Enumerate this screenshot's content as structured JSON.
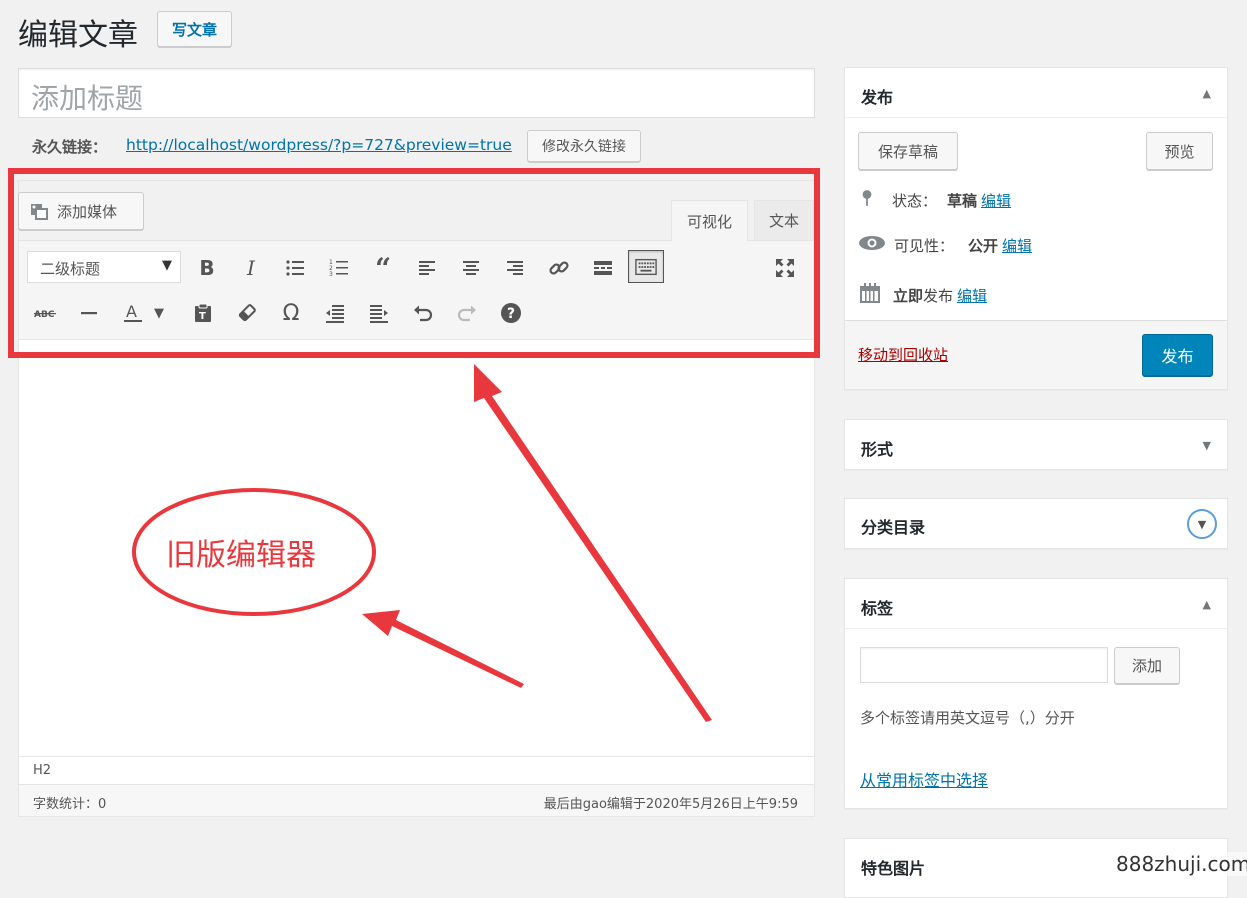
{
  "header": {
    "title": "编辑文章",
    "add_new_label": "写文章"
  },
  "editor": {
    "title_placeholder": "添加标题",
    "permalink_label": "永久链接：",
    "permalink_url": "http://localhost/wordpress/?p=727&preview=true",
    "edit_permalink_label": "修改永久链接",
    "add_media_label": "添加媒体",
    "tab_visual": "可视化",
    "tab_text": "文本",
    "format_select": "二级标题",
    "path": "H2",
    "word_count": "字数统计：0",
    "last_edited": "最后由gao编辑于2020年5月26日上午9:59"
  },
  "annotation": {
    "label": "旧版编辑器",
    "color": "#e8383d"
  },
  "publish": {
    "title": "发布",
    "save_draft": "保存草稿",
    "preview": "预览",
    "status_label": "状态：",
    "status_value": "草稿",
    "visibility_label": "可见性：",
    "visibility_value": "公开",
    "schedule_bold": "立即",
    "schedule_rest": "发布",
    "edit_link": "编辑",
    "trash": "移动到回收站",
    "publish_button": "发布"
  },
  "format_box": {
    "title": "形式"
  },
  "categories_box": {
    "title": "分类目录"
  },
  "tags_box": {
    "title": "标签",
    "add_button": "添加",
    "hint": "多个标签请用英文逗号（,）分开",
    "choose_link": "从常用标签中选择"
  },
  "featured_box": {
    "title": "特色图片"
  },
  "watermark": "888zhuji.com",
  "colors": {
    "accent": "#0073aa",
    "primary_button": "#0085ba",
    "trash": "#a00"
  }
}
